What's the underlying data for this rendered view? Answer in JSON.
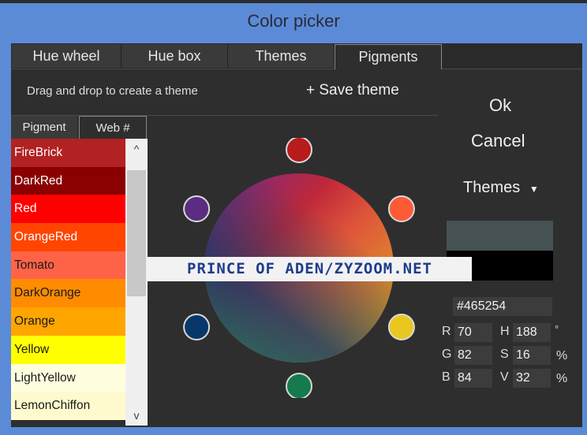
{
  "window": {
    "title": "Color picker"
  },
  "tabs": [
    {
      "label": "Hue wheel"
    },
    {
      "label": "Hue box"
    },
    {
      "label": "Themes"
    },
    {
      "label": "Pigments",
      "active": true
    }
  ],
  "toolbar": {
    "hint": "Drag and drop to create a theme",
    "save_label": "+ Save theme"
  },
  "subtabs": [
    {
      "label": "Pigment"
    },
    {
      "label": "Web #",
      "active": true
    }
  ],
  "pigments": [
    {
      "name": "FireBrick",
      "color": "#b22222",
      "text": "#ffffff"
    },
    {
      "name": "DarkRed",
      "color": "#8b0000",
      "text": "#ffffff"
    },
    {
      "name": "Red",
      "color": "#ff0000",
      "text": "#ffffff"
    },
    {
      "name": "OrangeRed",
      "color": "#ff4500",
      "text": "#ffffff"
    },
    {
      "name": "Tomato",
      "color": "#ff6347",
      "text": "#1a1a1a"
    },
    {
      "name": "DarkOrange",
      "color": "#ff8c00",
      "text": "#1a1a1a"
    },
    {
      "name": "Orange",
      "color": "#ffa500",
      "text": "#1a1a1a"
    },
    {
      "name": "Yellow",
      "color": "#ffff00",
      "text": "#1a1a1a"
    },
    {
      "name": "LightYellow",
      "color": "#ffffe0",
      "text": "#1a1a1a"
    },
    {
      "name": "LemonChiffon",
      "color": "#fffacd",
      "text": "#1a1a1a"
    }
  ],
  "scrollbar": {
    "up_icon": "chevron-up-icon",
    "down_icon": "chevron-down-icon",
    "up_glyph": "^",
    "down_glyph": "v"
  },
  "theme_dots": [
    "#b81c1c",
    "#ff5a36",
    "#e8c81e",
    "#157a4e",
    "#08386a",
    "#5a2d82"
  ],
  "actions": {
    "ok_label": "Ok",
    "cancel_label": "Cancel",
    "themes_label": "Themes",
    "themes_caret": "▼"
  },
  "swatches": {
    "current": "#465254",
    "previous": "#000000"
  },
  "color": {
    "hex": "#465254",
    "r_label": "R",
    "r": "70",
    "g_label": "G",
    "g": "82",
    "b_label": "B",
    "b": "84",
    "h_label": "H",
    "h": "188",
    "h_unit": "°",
    "s_label": "S",
    "s": "16",
    "s_unit": "%",
    "v_label": "V",
    "v": "32",
    "v_unit": "%"
  },
  "watermark": {
    "text": "PRINCE OF ADEN/ZYZOOM.NET"
  }
}
